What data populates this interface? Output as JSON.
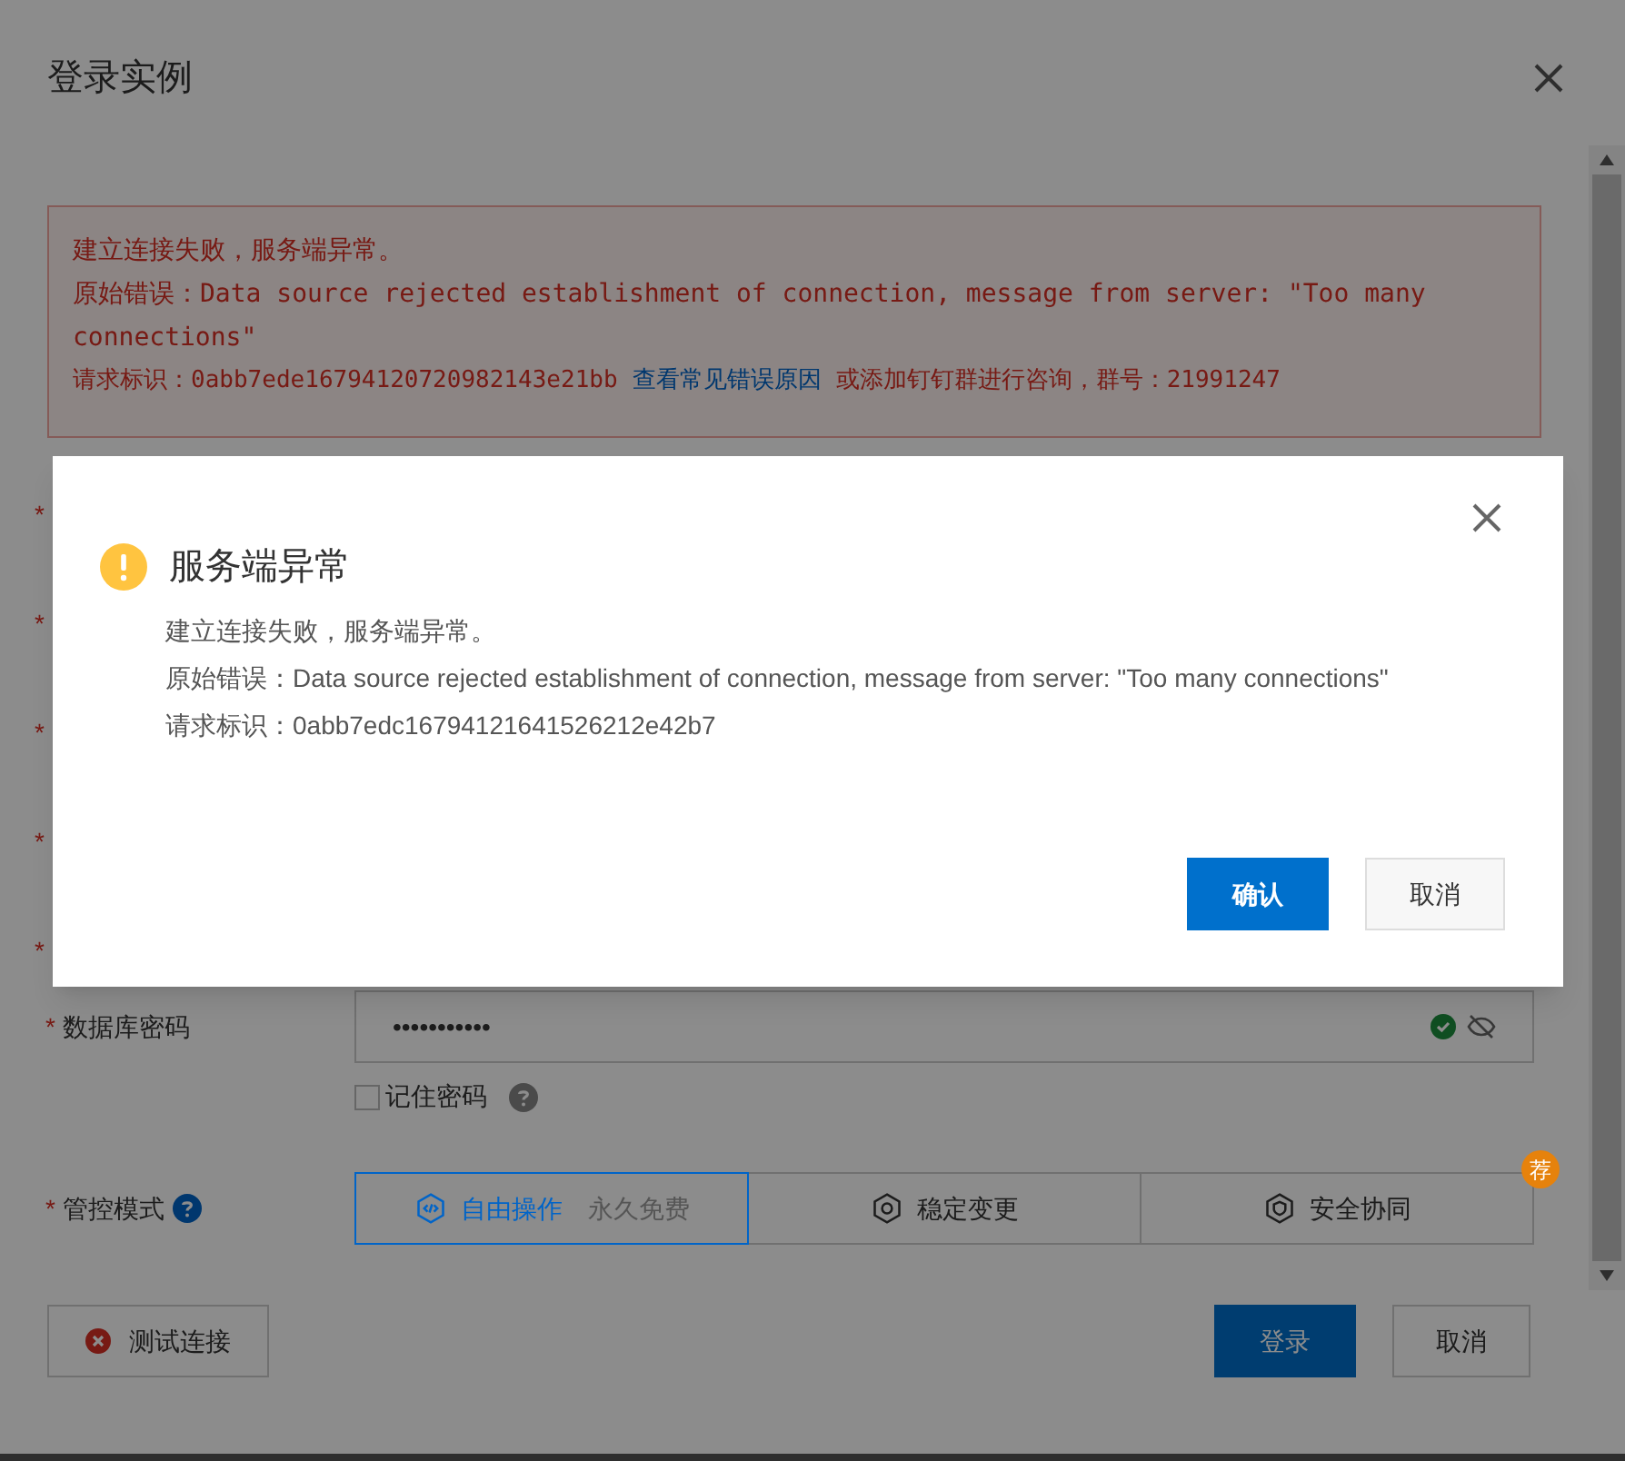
{
  "dialog": {
    "title": "登录实例"
  },
  "error_box": {
    "line1": "建立连接失败，服务端异常。",
    "line2_label": "原始错误：",
    "line2_text": "Data source rejected establishment of connection,  message from server: \"Too many connections\"",
    "line3_label": "请求标识：",
    "request_id": "0abb7ede16794120720982143e21bb",
    "link": "查看常见错误原因",
    "line3_tail": "或添加钉钉群进行咨询，群号：21991247"
  },
  "hidden_rows": [
    {
      "mark": "*"
    },
    {
      "mark": "*"
    },
    {
      "mark": "*"
    },
    {
      "mark": "*"
    },
    {
      "mark": "*"
    }
  ],
  "password": {
    "label": "数据库密码",
    "mark": "*",
    "value": "•••••••••••",
    "valid": true
  },
  "remember": {
    "label": "记住密码",
    "checked": false
  },
  "control_mode": {
    "label": "管控模式",
    "mark": "*",
    "badge": "荐",
    "options": [
      {
        "label": "自由操作",
        "note": "永久免费",
        "selected": true
      },
      {
        "label": "稳定变更",
        "selected": false
      },
      {
        "label": "安全协同",
        "selected": false
      }
    ]
  },
  "footer": {
    "test_button": "测试连接",
    "login_button": "登录",
    "cancel_button": "取消"
  },
  "modal": {
    "title": "服务端异常",
    "lines": [
      "建立连接失败，服务端异常。",
      "原始错误：Data source rejected establishment of connection, message from server: \"Too many connections\"",
      "请求标识：0abb7edc16794121641526212e42b7"
    ],
    "confirm": "确认",
    "cancel": "取消"
  }
}
